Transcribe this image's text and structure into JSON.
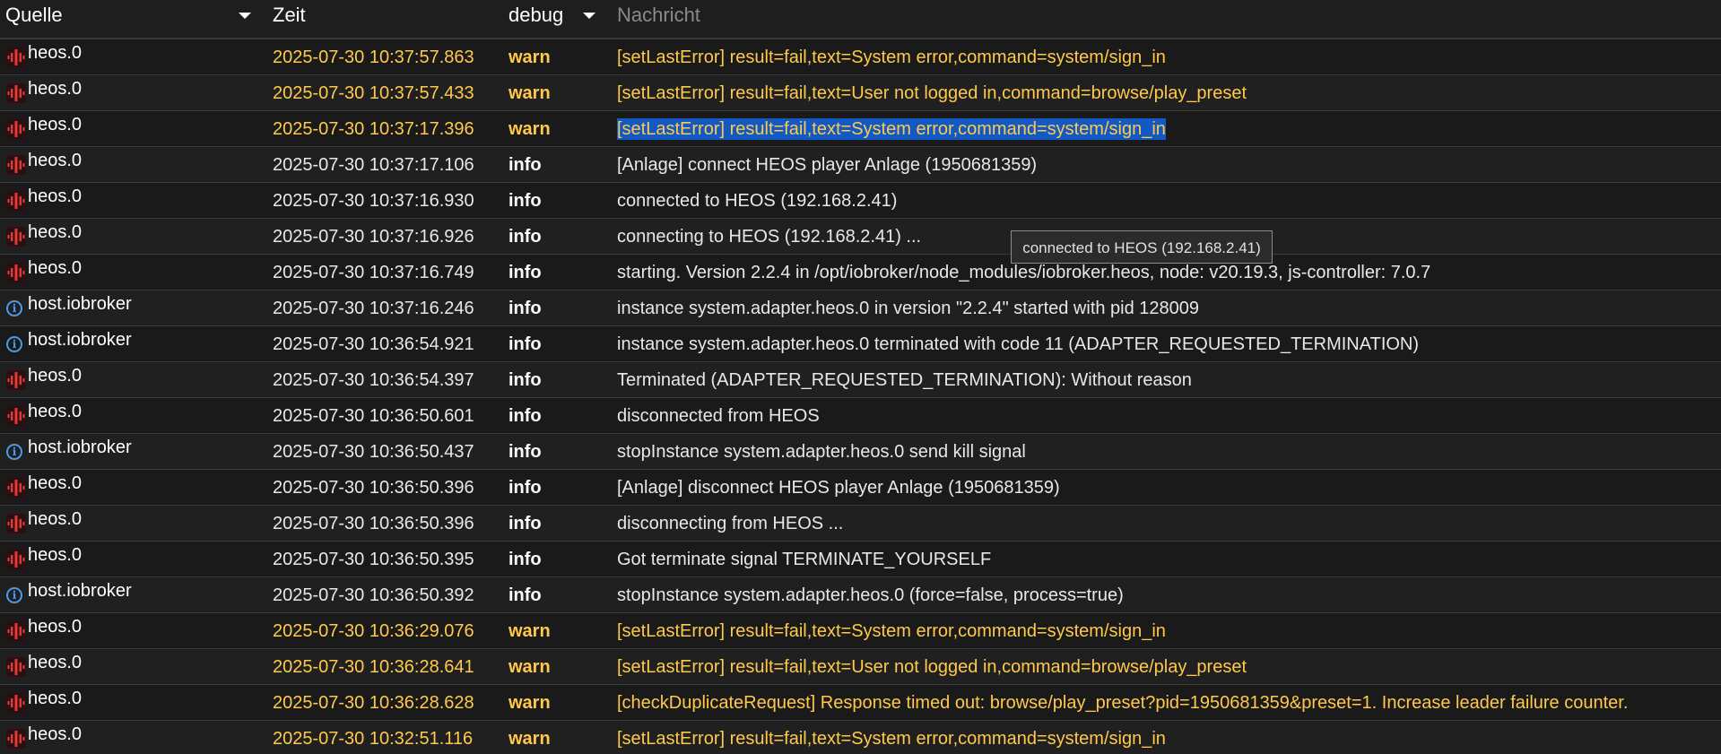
{
  "header": {
    "source_label": "Quelle",
    "time_label": "Zeit",
    "level_label": "debug",
    "message_label": "Nachricht"
  },
  "colors": {
    "background": "#1e1e1e",
    "warn": "#ffc94a",
    "info_text": "#e8e8e8",
    "selection": "#1259c4",
    "host_icon": "#4a9be8"
  },
  "tooltip": {
    "text": "connected to HEOS (192.168.2.41)"
  },
  "rows": [
    {
      "icon": "heos-adapter-icon",
      "source": "heos.0",
      "time": "2025-07-30 10:37:57.863",
      "level": "warn",
      "message": "[setLastError] result=fail,text=System error,command=system/sign_in"
    },
    {
      "icon": "heos-adapter-icon",
      "source": "heos.0",
      "time": "2025-07-30 10:37:57.433",
      "level": "warn",
      "message": "[setLastError] result=fail,text=User not logged in,command=browse/play_preset"
    },
    {
      "icon": "heos-adapter-icon",
      "source": "heos.0",
      "time": "2025-07-30 10:37:17.396",
      "level": "warn",
      "message": "[setLastError] result=fail,text=System error,command=system/sign_in",
      "selected": true
    },
    {
      "icon": "heos-adapter-icon",
      "source": "heos.0",
      "time": "2025-07-30 10:37:17.106",
      "level": "info",
      "message": "[Anlage] connect HEOS player Anlage (1950681359)"
    },
    {
      "icon": "heos-adapter-icon",
      "source": "heos.0",
      "time": "2025-07-30 10:37:16.930",
      "level": "info",
      "message": "connected to HEOS (192.168.2.41)"
    },
    {
      "icon": "heos-adapter-icon",
      "source": "heos.0",
      "time": "2025-07-30 10:37:16.926",
      "level": "info",
      "message": "connecting to HEOS (192.168.2.41) ..."
    },
    {
      "icon": "heos-adapter-icon",
      "source": "heos.0",
      "time": "2025-07-30 10:37:16.749",
      "level": "info",
      "message": "starting. Version 2.2.4 in /opt/iobroker/node_modules/iobroker.heos, node: v20.19.3, js-controller: 7.0.7"
    },
    {
      "icon": "info-icon",
      "source": "host.iobroker",
      "time": "2025-07-30 10:37:16.246",
      "level": "info",
      "message": "instance system.adapter.heos.0 in version \"2.2.4\" started with pid 128009"
    },
    {
      "icon": "info-icon",
      "source": "host.iobroker",
      "time": "2025-07-30 10:36:54.921",
      "level": "info",
      "message": "instance system.adapter.heos.0 terminated with code 11 (ADAPTER_REQUESTED_TERMINATION)"
    },
    {
      "icon": "heos-adapter-icon",
      "source": "heos.0",
      "time": "2025-07-30 10:36:54.397",
      "level": "info",
      "message": "Terminated (ADAPTER_REQUESTED_TERMINATION): Without reason"
    },
    {
      "icon": "heos-adapter-icon",
      "source": "heos.0",
      "time": "2025-07-30 10:36:50.601",
      "level": "info",
      "message": "disconnected from HEOS"
    },
    {
      "icon": "info-icon",
      "source": "host.iobroker",
      "time": "2025-07-30 10:36:50.437",
      "level": "info",
      "message": "stopInstance system.adapter.heos.0 send kill signal"
    },
    {
      "icon": "heos-adapter-icon",
      "source": "heos.0",
      "time": "2025-07-30 10:36:50.396",
      "level": "info",
      "message": "[Anlage] disconnect HEOS player Anlage (1950681359)"
    },
    {
      "icon": "heos-adapter-icon",
      "source": "heos.0",
      "time": "2025-07-30 10:36:50.396",
      "level": "info",
      "message": "disconnecting from HEOS ..."
    },
    {
      "icon": "heos-adapter-icon",
      "source": "heos.0",
      "time": "2025-07-30 10:36:50.395",
      "level": "info",
      "message": "Got terminate signal TERMINATE_YOURSELF"
    },
    {
      "icon": "info-icon",
      "source": "host.iobroker",
      "time": "2025-07-30 10:36:50.392",
      "level": "info",
      "message": "stopInstance system.adapter.heos.0 (force=false, process=true)"
    },
    {
      "icon": "heos-adapter-icon",
      "source": "heos.0",
      "time": "2025-07-30 10:36:29.076",
      "level": "warn",
      "message": "[setLastError] result=fail,text=System error,command=system/sign_in"
    },
    {
      "icon": "heos-adapter-icon",
      "source": "heos.0",
      "time": "2025-07-30 10:36:28.641",
      "level": "warn",
      "message": "[setLastError] result=fail,text=User not logged in,command=browse/play_preset"
    },
    {
      "icon": "heos-adapter-icon",
      "source": "heos.0",
      "time": "2025-07-30 10:36:28.628",
      "level": "warn",
      "message": "[checkDuplicateRequest] Response timed out: browse/play_preset?pid=1950681359&preset=1. Increase leader failure counter."
    },
    {
      "icon": "heos-adapter-icon",
      "source": "heos.0",
      "time": "2025-07-30 10:32:51.116",
      "level": "warn",
      "message": "[setLastError] result=fail,text=System error,command=system/sign_in"
    }
  ]
}
